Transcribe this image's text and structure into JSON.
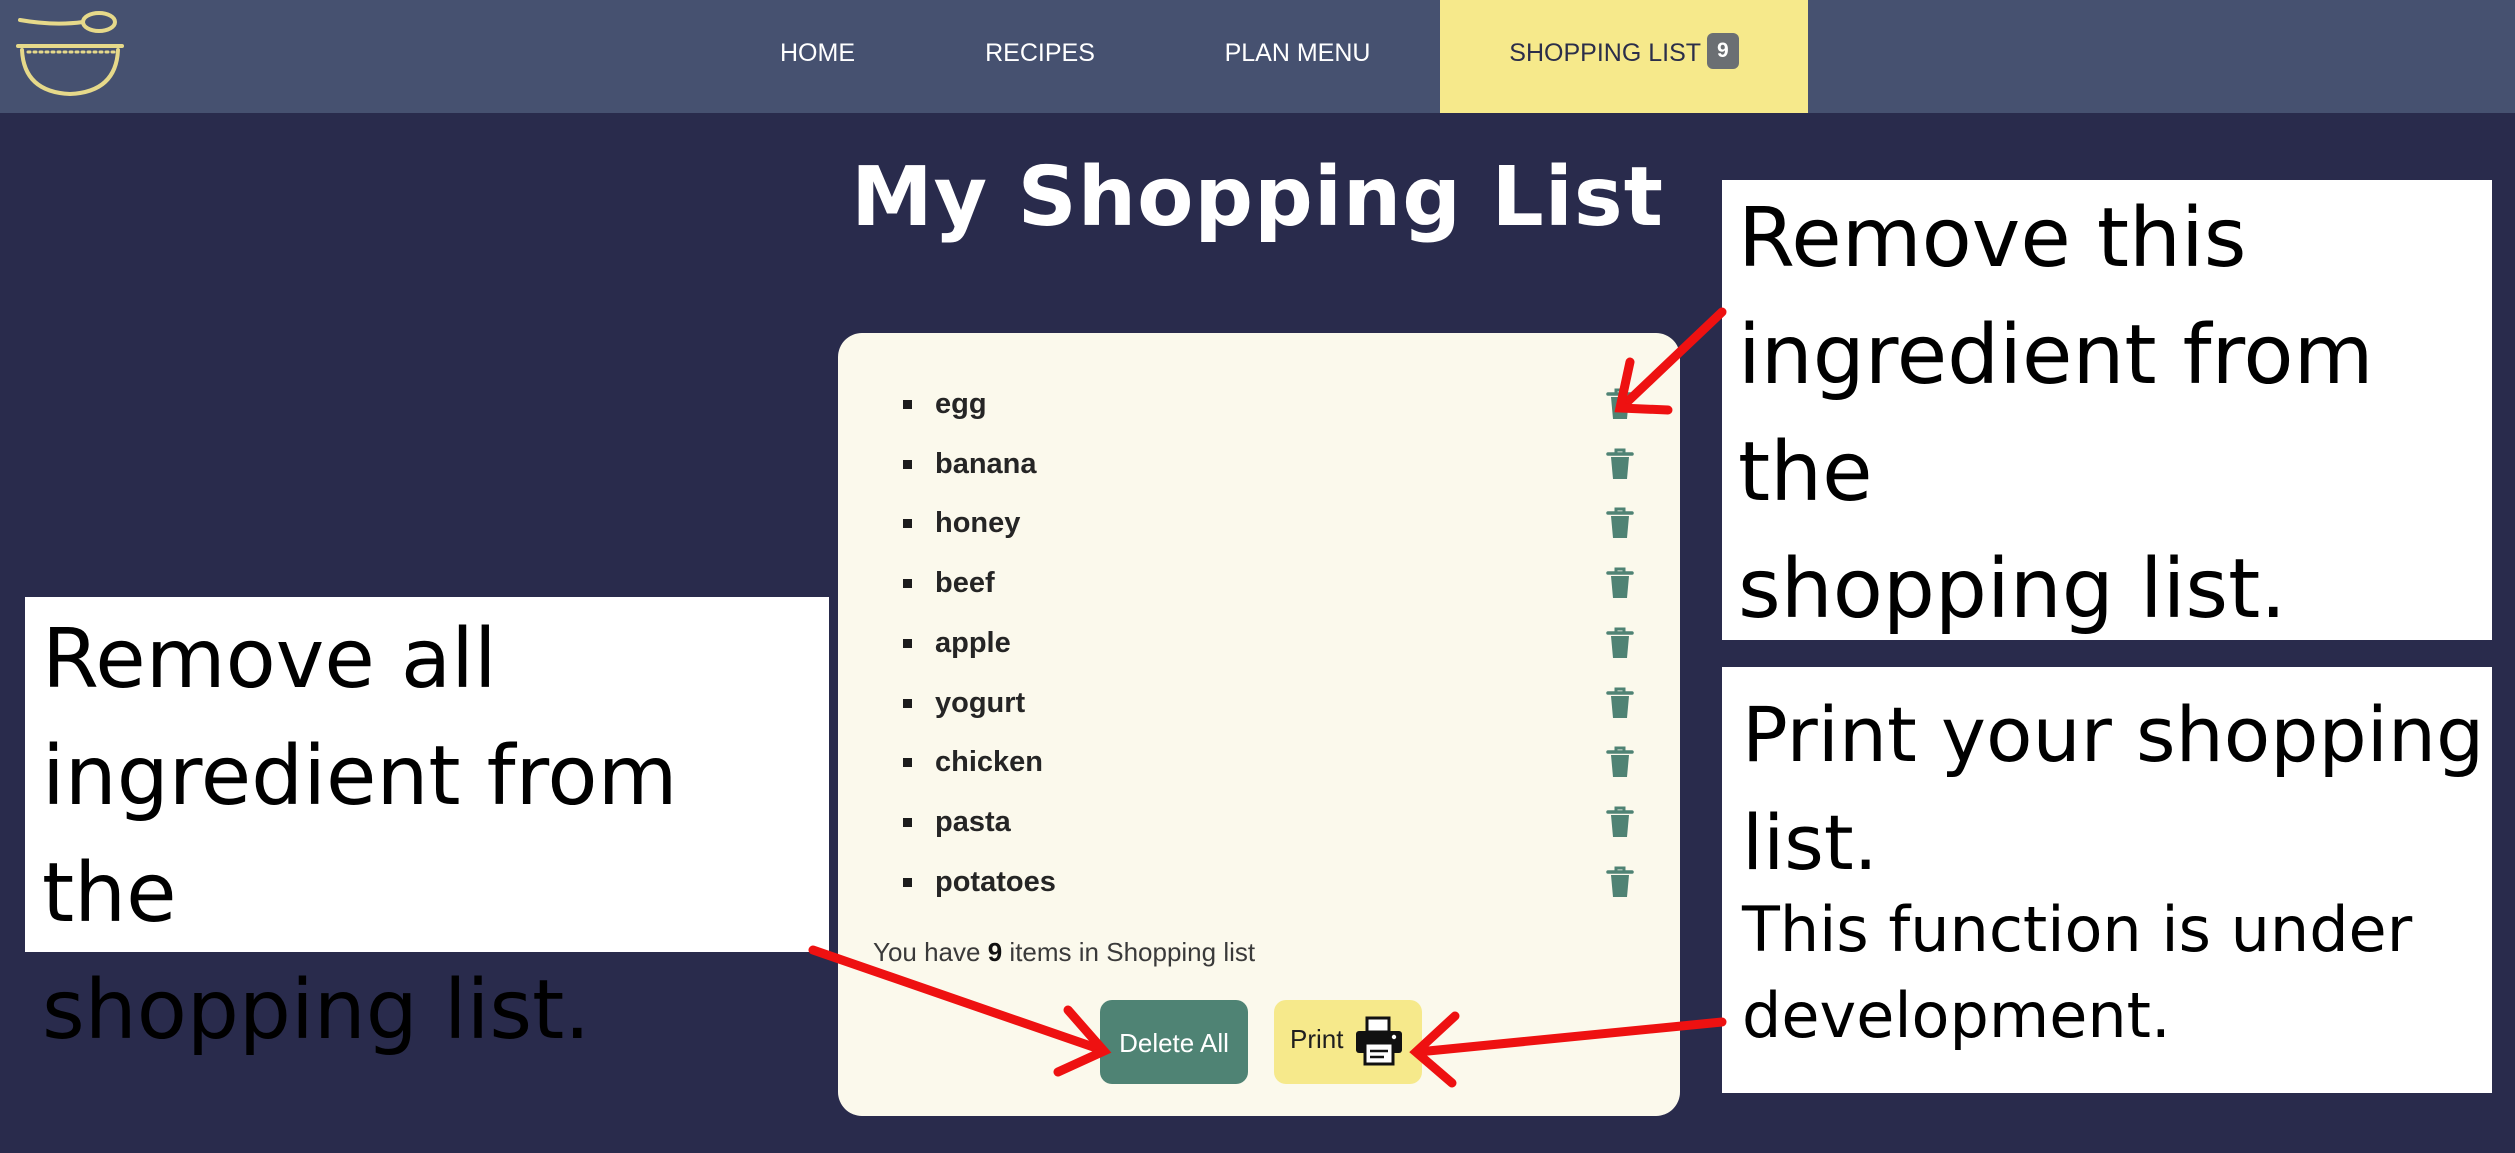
{
  "nav": {
    "items": [
      {
        "label": "HOME"
      },
      {
        "label": "RECIPES"
      },
      {
        "label": "PLAN MENU"
      },
      {
        "label": "SHOPPING LIST",
        "badge": "9"
      }
    ],
    "active_color": "#f6e98b",
    "background": "#465170"
  },
  "page": {
    "title": "My Shopping List",
    "background": "#292b4c"
  },
  "shopping_list": {
    "items": [
      "egg",
      "banana",
      "honey",
      "beef",
      "apple",
      "yogurt",
      "chicken",
      "pasta",
      "potatoes"
    ],
    "summary_prefix": "You have",
    "count": "9",
    "summary_suffix": "items in Shopping list",
    "delete_all_label": "Delete All",
    "print_label": "Print",
    "icons": {
      "remove": "trash-icon",
      "print": "printer-icon"
    },
    "colors": {
      "delete": "#4f8374",
      "print": "#f6e98b",
      "card": "#fbf9ec"
    }
  },
  "annotations": {
    "remove_one": "Remove this\ningredient from\nthe\nshopping list.",
    "remove_all": "Remove all\ningredient from the\nshopping list.",
    "print_title": "Print your shopping\nlist.",
    "print_note": "This function is under\ndevelopment.",
    "arrow_color": "#ee1111"
  }
}
